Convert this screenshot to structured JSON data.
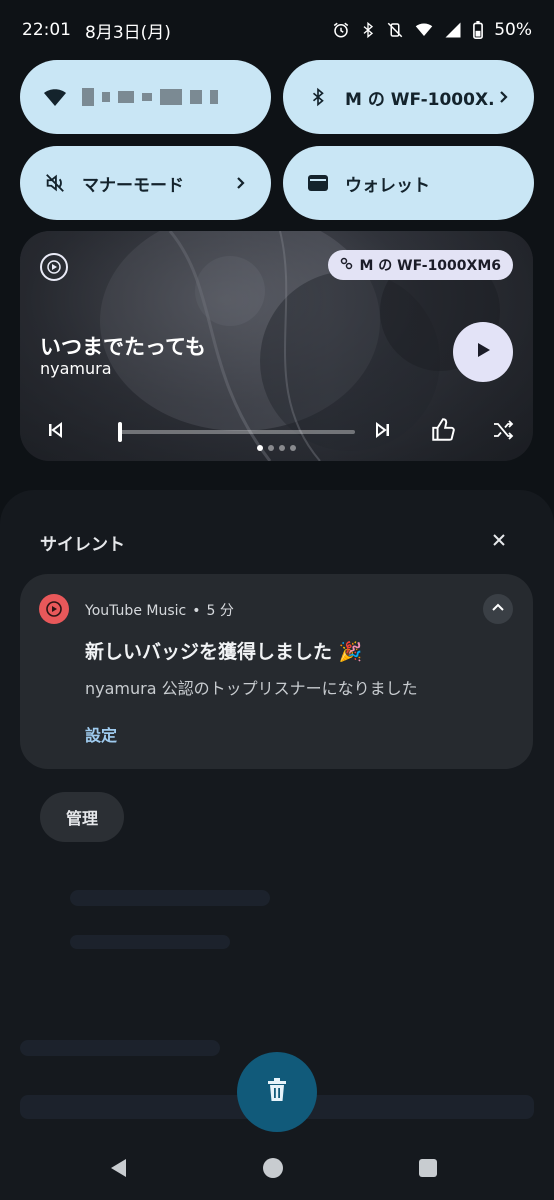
{
  "status_bar": {
    "time": "22:01",
    "date": "8月3日(月)",
    "battery": "50%"
  },
  "quick_settings": {
    "wifi": {
      "label": ""
    },
    "bluetooth": {
      "label": "M の WF-1000X.."
    },
    "sound": {
      "label": "マナーモード"
    },
    "wallet": {
      "label": "ウォレット"
    }
  },
  "media": {
    "device": "M の WF-1000XM6",
    "title": "いつまでたっても",
    "artist": "nyamura",
    "progress_fraction": 0.0,
    "page_count": 4,
    "active_page": 0
  },
  "notifications": {
    "section_title": "サイレント",
    "card": {
      "app_name": "YouTube Music",
      "separator": "•",
      "time": "5 分",
      "title": "新しいバッジを獲得しました 🎉",
      "body": "nyamura 公認のトップリスナーになりました",
      "action": "設定"
    },
    "manage_label": "管理"
  },
  "colors": {
    "tile_bg": "#c9e6f5",
    "card_bg": "#262a2f",
    "accent_link": "#9fcbef",
    "fab_bg": "#115a7a",
    "yt_red": "#e8585a"
  },
  "icons": [
    "alarm-icon",
    "bluetooth-icon",
    "vibrate-off-icon",
    "wifi-icon",
    "signal-icon",
    "battery-icon",
    "play-icon",
    "skip-previous-icon",
    "skip-next-icon",
    "thumb-up-icon",
    "shuffle-icon",
    "close-icon",
    "chevron-up-icon",
    "trash-icon",
    "back-icon",
    "home-icon",
    "recents-icon"
  ]
}
